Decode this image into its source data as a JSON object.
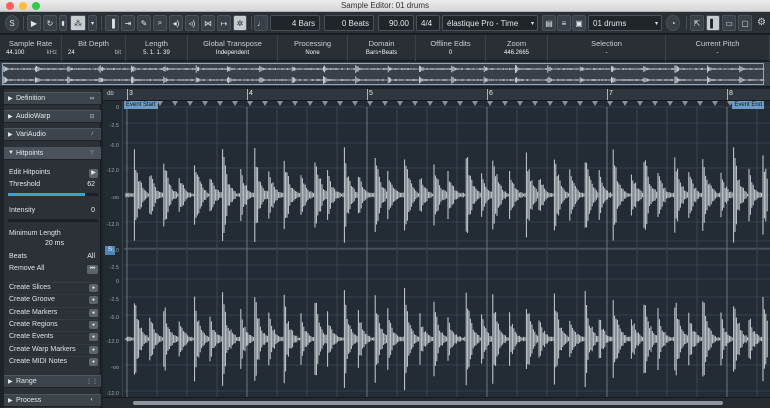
{
  "window": {
    "title": "Sample Editor: 01 drums"
  },
  "toolbar": {
    "length_bars": "4 Bars",
    "offset_beats": "0 Beats",
    "tempo": "90.00",
    "signature": "4/4",
    "algorithm": "élastique Pro - Time",
    "clip_name": "01 drums",
    "musical_mode_label": "♩"
  },
  "infoline": {
    "columns": [
      {
        "header": "Sample Rate",
        "value": "44.100",
        "unit": "kHz"
      },
      {
        "header": "Bit Depth",
        "value": "24",
        "unit": "bit"
      },
      {
        "header": "Length",
        "value": "5. 1. 1. 39",
        "unit": ""
      },
      {
        "header": "Global Transpose",
        "value": "Independent",
        "unit": ""
      },
      {
        "header": "Processing",
        "value": "None",
        "unit": ""
      },
      {
        "header": "Domain",
        "value": "Bars+Beats",
        "unit": ""
      },
      {
        "header": "Offline Edits",
        "value": "0",
        "unit": ""
      },
      {
        "header": "Zoom",
        "value": "446.2665",
        "unit": ""
      },
      {
        "header": "Selection",
        "value": "-",
        "unit": ""
      },
      {
        "header": "Current Pitch",
        "value": "-",
        "unit": ""
      }
    ]
  },
  "inspector": {
    "sections": {
      "definition": "Definition",
      "audiowarp": "AudioWarp",
      "variaudio": "VariAudio",
      "hitpoints": "Hitpoints",
      "range": "Range",
      "process": "Process"
    },
    "hitpoints": {
      "edit_hitpoints": "Edit Hitpoints",
      "threshold_label": "Threshold",
      "threshold_value": "62",
      "threshold_fill": 0.86,
      "intensity_label": "Intensity",
      "intensity_value": "0",
      "min_length_label": "Minimum Length",
      "min_length_value": "20 ms",
      "beats_label": "Beats",
      "beats_value": "All",
      "remove_all": "Remove All"
    },
    "actions": [
      "Create Slices",
      "Create Groove",
      "Create Markers",
      "Create Regions",
      "Create Events",
      "Create Warp Markers",
      "Create MIDI Notes"
    ]
  },
  "editor": {
    "ruler_bars": [
      "3",
      "4",
      "5",
      "6",
      "7",
      "8"
    ],
    "event_start": "Event Start",
    "event_end": "Event End",
    "scale_unit": "db",
    "scale_ticks": [
      "0",
      "-2.5",
      "-6.0",
      "-12.0",
      "-oo",
      "-12.0",
      "-6.0",
      "-2.5",
      "0",
      "-2.5",
      "-6.0",
      "-12.0",
      "-oo",
      "-12.0",
      "-6.0",
      "-2.5"
    ],
    "snap_label": "S"
  },
  "colors": {
    "background": "#1e2329",
    "accent": "#3aa5c8",
    "waveform": "#c9ced3",
    "event_label": "#6d9cc6"
  }
}
